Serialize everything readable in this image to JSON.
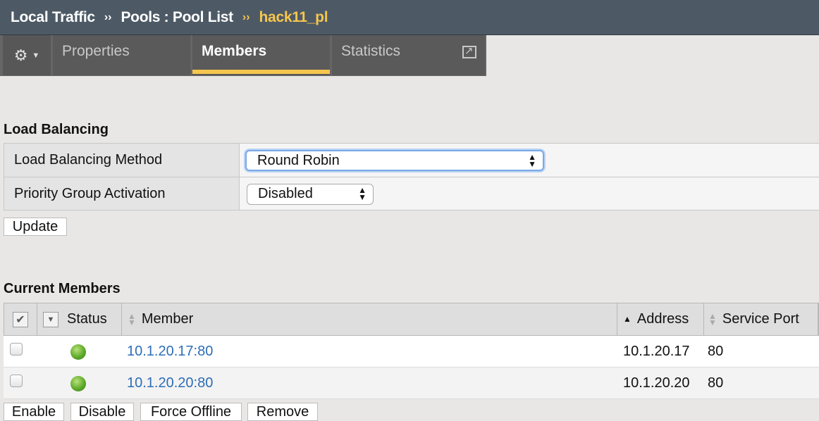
{
  "breadcrumb": {
    "section": "Local Traffic",
    "sep1": "››",
    "page": "Pools : Pool List",
    "sep2": "››",
    "current": "hack11_pl"
  },
  "tabs": [
    {
      "label": "Properties",
      "active": false
    },
    {
      "label": "Members",
      "active": true
    },
    {
      "label": "Statistics",
      "active": false
    }
  ],
  "tab_icons": {
    "settings": "gear-icon",
    "external": "external-link-icon"
  },
  "load_balancing": {
    "title": "Load Balancing",
    "method_label": "Load Balancing Method",
    "method_value": "Round Robin",
    "priority_label": "Priority Group Activation",
    "priority_value": "Disabled",
    "update_button": "Update"
  },
  "members": {
    "title": "Current Members",
    "columns": {
      "status": "Status",
      "member": "Member",
      "address": "Address",
      "service_port": "Service Port"
    },
    "rows": [
      {
        "member": "10.1.20.17:80",
        "address": "10.1.20.17",
        "port": "80",
        "status": "green"
      },
      {
        "member": "10.1.20.20:80",
        "address": "10.1.20.20",
        "port": "80",
        "status": "green"
      }
    ],
    "actions": {
      "enable": "Enable",
      "disable": "Disable",
      "force_offline": "Force Offline",
      "remove": "Remove"
    }
  },
  "colors": {
    "header_bg": "#4d5a66",
    "accent": "#f6c64e",
    "link": "#2e6db7",
    "status_ok": "#5faa2a"
  }
}
